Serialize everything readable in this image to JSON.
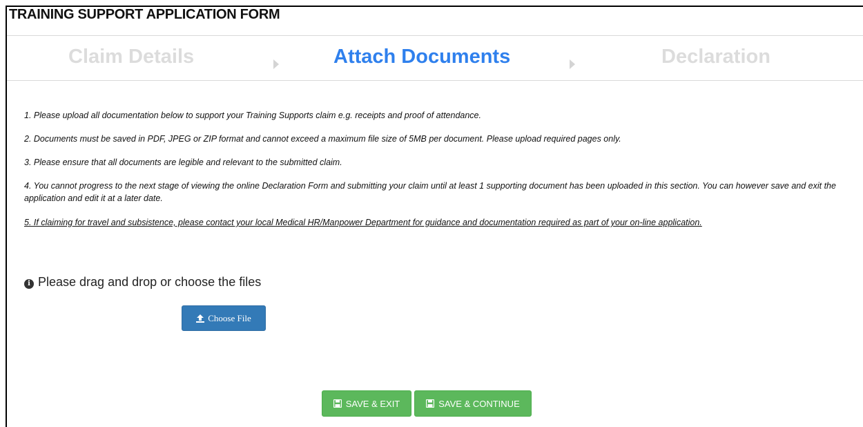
{
  "header": {
    "title": "TRAINING SUPPORT APPLICATION FORM"
  },
  "steps": [
    {
      "label": "Claim Details",
      "state": "inactive"
    },
    {
      "label": "Attach Documents",
      "state": "active"
    },
    {
      "label": "Declaration",
      "state": "inactive"
    }
  ],
  "colors": {
    "active_step": "#2f80ed",
    "inactive_step": "#dcdcdc",
    "primary_button": "#337ab7",
    "success_button": "#5cb85c"
  },
  "instructions": [
    "1. Please upload all documentation below to support your Training Supports claim e.g. receipts and proof of attendance.",
    "2. Documents must be saved in PDF, JPEG or ZIP format and cannot exceed a maximum file size of 5MB per document. Please upload required pages only.",
    "3. Please ensure that all documents are legible and relevant to the submitted claim.",
    "4. You cannot progress to the next stage of viewing the online Declaration Form and submitting your claim until at least 1 supporting document has been uploaded in this section. You can however save and exit the application and edit it at a later date.",
    "5. If claiming for travel and subsistence, please contact your local Medical HR/Manpower Department for guidance and documentation required as part of your on-line application."
  ],
  "upload": {
    "hint": "Please drag and drop or choose the files",
    "hint_icon": "info-circle-icon",
    "choose_label": "Choose File",
    "choose_icon": "upload-icon"
  },
  "actions": {
    "save_exit_label": "SAVE & EXIT",
    "save_continue_label": "SAVE & CONTINUE",
    "icon": "floppy-disk-icon"
  }
}
